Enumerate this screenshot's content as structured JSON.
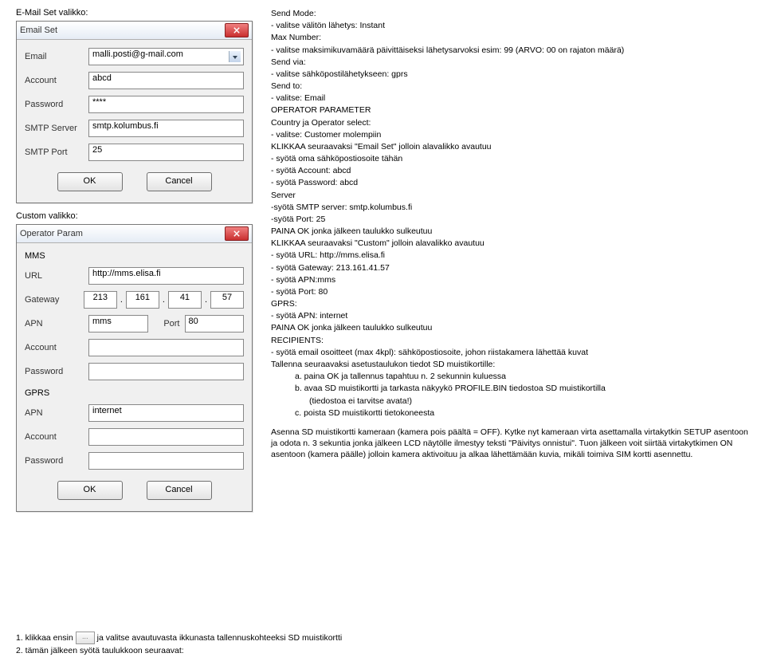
{
  "captions": {
    "emailSetCaption": "E-Mail Set valikko:",
    "customCaption": "Custom valikko:"
  },
  "emailWindow": {
    "title": "Email Set",
    "labels": {
      "email": "Email",
      "account": "Account",
      "password": "Password",
      "smtpServer": "SMTP Server",
      "smtpPort": "SMTP Port"
    },
    "values": {
      "email": "malli.posti@g-mail.com",
      "account": "abcd",
      "password": "****",
      "smtpServer": "smtp.kolumbus.fi",
      "smtpPort": "25"
    },
    "buttons": {
      "ok": "OK",
      "cancel": "Cancel"
    }
  },
  "customWindow": {
    "title": "Operator Param",
    "section1": "MMS",
    "labels": {
      "url": "URL",
      "gateway": "Gateway",
      "apn": "APN",
      "port": "Port",
      "account": "Account",
      "password": "Password"
    },
    "values": {
      "url": "http://mms.elisa.fi",
      "gw1": "213",
      "gw2": "161",
      "gw3": "41",
      "gw4": "57",
      "apn": "mms",
      "port": "80",
      "account": "",
      "password": ""
    },
    "section2": "GPRS",
    "gprs": {
      "apn": "internet",
      "account": "",
      "password": ""
    },
    "buttons": {
      "ok": "OK",
      "cancel": "Cancel"
    }
  },
  "instr": {
    "l1": "Send Mode:",
    "l2": "- valitse välitön lähetys: Instant",
    "l3": "Max Number:",
    "l4": "- valitse maksimikuvamäärä päivittäiseksi lähetysarvoksi esim: 99 (ARVO: 00 on rajaton määrä)",
    "l5": "Send via:",
    "l6": "- valitse sähköpostilähetykseen: gprs",
    "l7": "Send to:",
    "l8": "- valitse: Email",
    "l9": "OPERATOR PARAMETER",
    "l10": "Country ja Operator select:",
    "l11": "- valitse: Customer molempiin",
    "l12": "KLIKKAA seuraavaksi \"Email Set\" jolloin alavalikko avautuu",
    "l13": "- syötä oma sähköpostiosoite tähän",
    "l14": "- syötä Account: abcd",
    "l15": " - syötä Password: abcd",
    "l16": "Server",
    "l17": "-syötä SMTP server: smtp.kolumbus.fi",
    "l18": "-syötä Port: 25",
    "l19": "PAINA OK jonka jälkeen taulukko sulkeutuu",
    "l20": "KLIKKAA seuraavaksi \"Custom\" jolloin alavalikko avautuu",
    "l21": "- syötä URL: http://mms.elisa.fi",
    "l22": "- syötä Gateway: 213.161.41.57",
    "l23": "- syötä APN:mms",
    "l24": "- syötä Port: 80",
    "l25": "GPRS:",
    "l26": "- syötä APN: internet",
    "l27": "PAINA OK jonka jälkeen taulukko sulkeutuu",
    "l28": "RECIPIENTS:",
    "l29": "- syötä email osoitteet (max 4kpl): sähköpostiosoite, johon riistakamera lähettää kuvat",
    "l30": "Tallenna seuraavaksi asetustaulukon tiedot SD muistikortille:",
    "l31": "a.  paina OK  ja tallennus tapahtuu n. 2 sekunnin kuluessa",
    "l32": "b.  avaa SD muistikortti ja tarkasta näkyykö PROFILE.BIN tiedostoa SD muistikortilla",
    "l32b": "(tiedostoa ei tarvitse avata!)",
    "l33": "c.  poista SD muistikortti tietokoneesta"
  },
  "mid": "Asenna SD muistikortti kameraan (kamera pois päältä = OFF). Kytke nyt kameraan virta asettamalla virtakytkin SETUP asentoon ja odota n. 3 sekuntia jonka jälkeen LCD näytölle ilmestyy teksti \"Päivitys onnistui\". Tuon jälkeen voit siirtää virtakytkimen ON asentoon (kamera päälle) jolloin kamera aktivoituu ja alkaa lähettämään kuvia, mikäli toimiva SIM kortti asennettu.",
  "foot": {
    "f1a": "1.   klikkaa ensin ",
    "f1b": " ja valitse avautuvasta ikkunasta tallennuskohteeksi SD muistikortti",
    "f2": "2.   tämän jälkeen syötä taulukkoon seuraavat:",
    "btn": "…"
  }
}
